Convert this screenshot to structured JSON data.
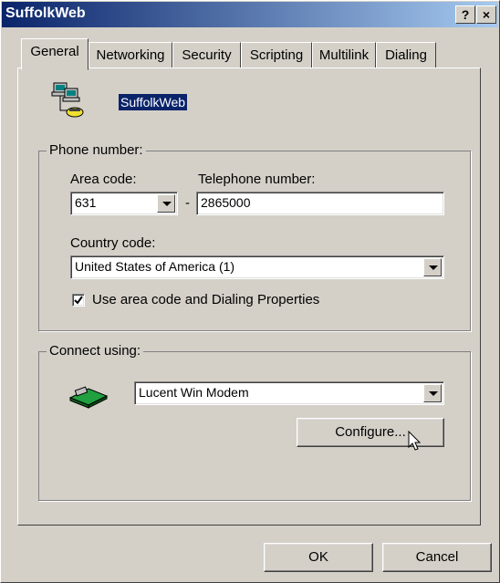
{
  "window": {
    "title": "SuffolkWeb",
    "help_button": "?",
    "close_button": "×"
  },
  "tabs": [
    {
      "label": "General"
    },
    {
      "label": "Networking"
    },
    {
      "label": "Security"
    },
    {
      "label": "Scripting"
    },
    {
      "label": "Multilink"
    },
    {
      "label": "Dialing"
    }
  ],
  "connection": {
    "name": "SuffolkWeb"
  },
  "phone": {
    "group_label": "Phone number:",
    "area_code_label": "Area code:",
    "area_code_value": "631",
    "dash": "-",
    "telephone_label": "Telephone number:",
    "telephone_value": "2865000",
    "country_label": "Country code:",
    "country_value": "United States of America (1)",
    "use_area_code_label": "Use area code and Dialing Properties",
    "use_area_code_checked": true
  },
  "connect": {
    "group_label": "Connect using:",
    "modem_value": "Lucent Win Modem",
    "configure_label": "Configure..."
  },
  "footer": {
    "ok_label": "OK",
    "cancel_label": "Cancel"
  },
  "icons": {
    "connection": "network-computers-icon",
    "modem": "modem-icon",
    "cursor": "mouse-cursor-icon"
  }
}
